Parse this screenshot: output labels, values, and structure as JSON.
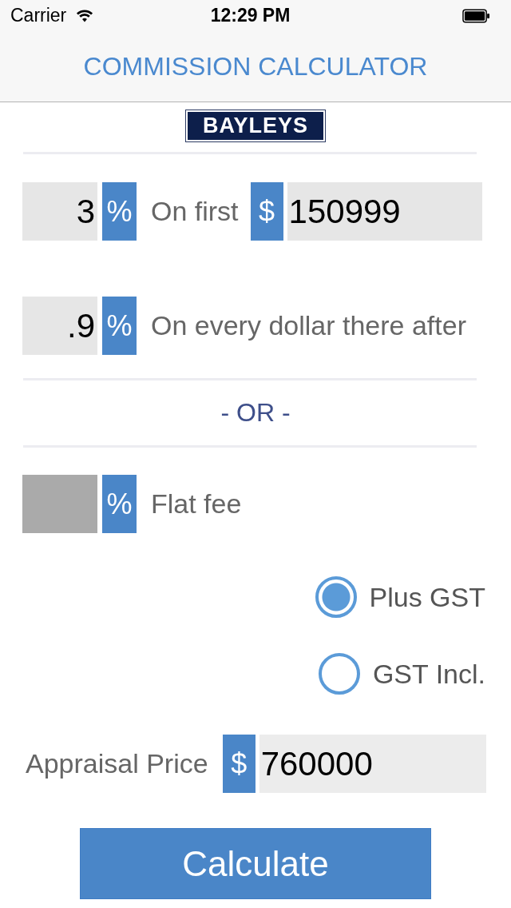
{
  "status_bar": {
    "carrier": "Carrier",
    "time": "12:29 PM"
  },
  "nav_bar": {
    "title": "COMMISSION CALCULATOR"
  },
  "logo": {
    "text": "BAYLEYS"
  },
  "tiered_rates": [
    {
      "value": "3",
      "unit": "%",
      "label": "On first",
      "disabled": false,
      "threshold": {
        "unit": "$",
        "value": "150999"
      }
    },
    {
      "value": ".9",
      "unit": "%",
      "label": "On every dollar there after",
      "disabled": false
    }
  ],
  "or_divider": "- OR -",
  "flat_fee": {
    "unit": "%",
    "label": "Flat fee",
    "disabled": true
  },
  "gst_options": [
    {
      "label": "Plus GST",
      "selected": true
    },
    {
      "label": "GST Incl.",
      "selected": false
    }
  ],
  "appraisal": {
    "label": "Appraisal Price",
    "unit": "$",
    "value": "760000"
  },
  "calculate_button": {
    "label": "Calculate"
  }
}
